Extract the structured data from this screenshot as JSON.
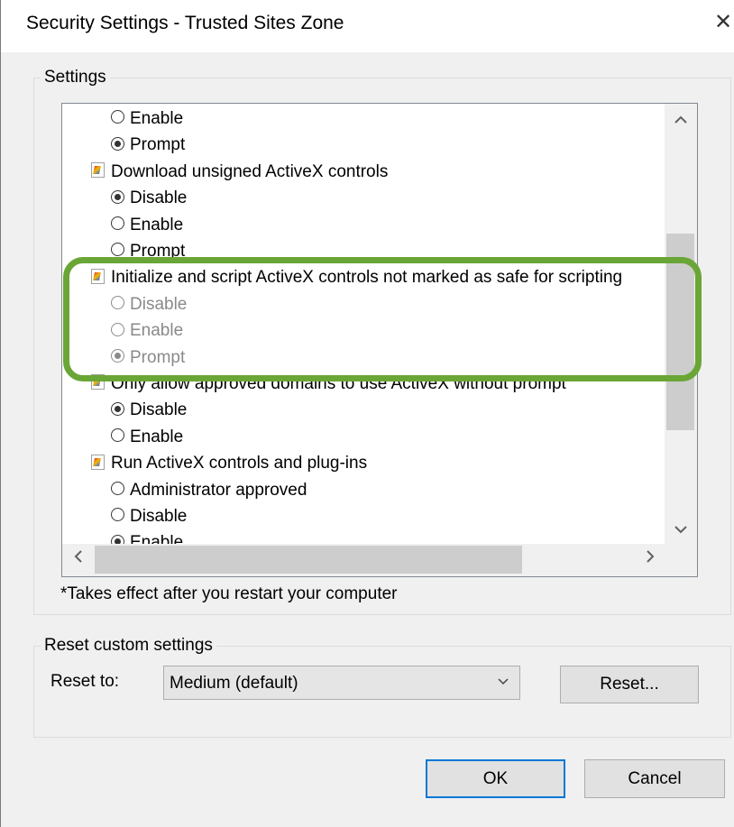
{
  "window": {
    "title": "Security Settings - Trusted Sites Zone",
    "close_glyph": "✕"
  },
  "settings_group": {
    "legend": "Settings",
    "rows": [
      {
        "kind": "option",
        "label": "Enable",
        "checked": false,
        "disabled": false
      },
      {
        "kind": "option",
        "label": "Prompt",
        "checked": true,
        "disabled": false
      },
      {
        "kind": "category",
        "label": "Download unsigned ActiveX controls",
        "icon": "activex-setting-icon"
      },
      {
        "kind": "option",
        "label": "Disable",
        "checked": true,
        "disabled": false
      },
      {
        "kind": "option",
        "label": "Enable",
        "checked": false,
        "disabled": false
      },
      {
        "kind": "option",
        "label": "Prompt",
        "checked": false,
        "disabled": false
      },
      {
        "kind": "category",
        "label": "Initialize and script ActiveX controls not marked as safe for scripting",
        "icon": "activex-setting-icon"
      },
      {
        "kind": "option",
        "label": "Disable",
        "checked": false,
        "disabled": true
      },
      {
        "kind": "option",
        "label": "Enable",
        "checked": false,
        "disabled": true
      },
      {
        "kind": "option",
        "label": "Prompt",
        "checked": true,
        "disabled": true
      },
      {
        "kind": "category",
        "label": "Only allow approved domains to use ActiveX without prompt",
        "icon": "activex-setting-icon"
      },
      {
        "kind": "option",
        "label": "Disable",
        "checked": true,
        "disabled": false
      },
      {
        "kind": "option",
        "label": "Enable",
        "checked": false,
        "disabled": false
      },
      {
        "kind": "category",
        "label": "Run ActiveX controls and plug-ins",
        "icon": "activex-setting-icon"
      },
      {
        "kind": "option",
        "label": "Administrator approved",
        "checked": false,
        "disabled": false
      },
      {
        "kind": "option",
        "label": "Disable",
        "checked": false,
        "disabled": false
      },
      {
        "kind": "option",
        "label": "Enable",
        "checked": true,
        "disabled": false
      }
    ],
    "scroll": {
      "up": "⌃",
      "down": "⌄",
      "left": "<",
      "right": ">"
    },
    "note": "*Takes effect after you restart your computer"
  },
  "reset_group": {
    "legend": "Reset custom settings",
    "reset_to_label": "Reset to:",
    "selected_level": "Medium (default)",
    "reset_button": "Reset..."
  },
  "footer": {
    "ok": "OK",
    "cancel": "Cancel"
  },
  "colors": {
    "highlight": "#6aa636",
    "default_button_border": "#0078d7"
  }
}
